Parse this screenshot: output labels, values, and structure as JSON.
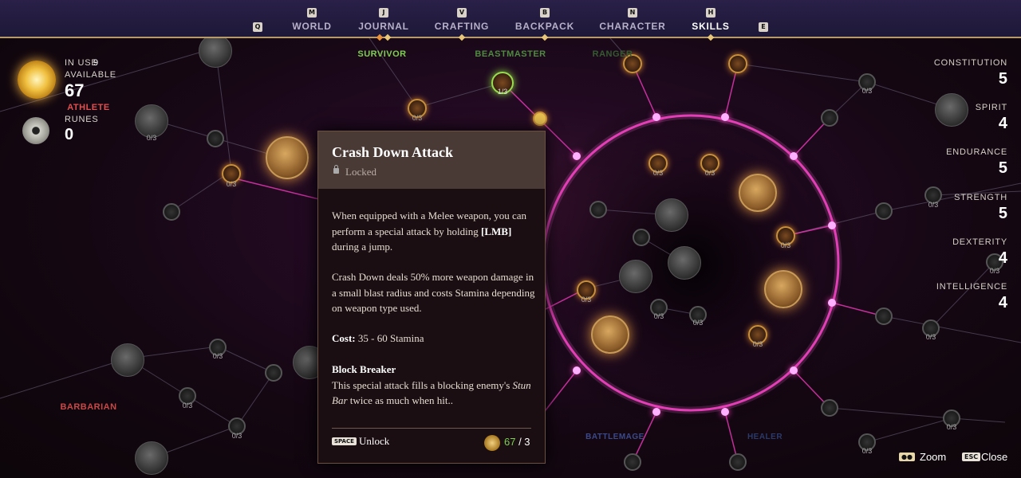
{
  "nav": {
    "items": [
      {
        "key": "Q",
        "label": ""
      },
      {
        "key": "M",
        "label": "WORLD"
      },
      {
        "key": "J",
        "label": "JOURNAL"
      },
      {
        "key": "V",
        "label": "CRAFTING"
      },
      {
        "key": "B",
        "label": "BACKPACK"
      },
      {
        "key": "N",
        "label": "CHARACTER"
      },
      {
        "key": "H",
        "label": "SKILLS"
      },
      {
        "key": "E",
        "label": ""
      }
    ],
    "active": "SKILLS"
  },
  "paths": {
    "survivor": "SURVIVOR",
    "beastmaster": "BEASTMASTER",
    "ranger": "RANGER",
    "athlete": "ATHLETE",
    "barbarian": "BARBARIAN",
    "battlemage": "BATTLEMAGE",
    "healer": "HEALER"
  },
  "hud": {
    "in_use_label": "IN USE",
    "in_use_value": "9",
    "available_label": "AVAILABLE",
    "available_value": "67",
    "runes_label": "RUNES",
    "runes_value": "0"
  },
  "stats": [
    {
      "label": "CONSTITUTION",
      "value": "5"
    },
    {
      "label": "SPIRIT",
      "value": "4"
    },
    {
      "label": "ENDURANCE",
      "value": "5"
    },
    {
      "label": "STRENGTH",
      "value": "5"
    },
    {
      "label": "DEXTERITY",
      "value": "4"
    },
    {
      "label": "INTELLIGENCE",
      "value": "4"
    }
  ],
  "node_labels": {
    "zero_of_three": "0/3",
    "one_of_three": "1/3"
  },
  "tooltip": {
    "title": "Crash Down Attack",
    "status": "Locked",
    "para1_a": "When equipped with a Melee weapon, you can perform a special attack by holding ",
    "para1_key": "[LMB]",
    "para1_b": " during a jump.",
    "para2": "Crash Down deals 50% more weapon damage in a small blast radius and costs Stamina depending on weapon type used.",
    "cost_label": "Cost:",
    "cost_value": " 35 - 60 Stamina",
    "perk_title": "Block Breaker",
    "perk_a": "This special attack fills a blocking enemy's ",
    "perk_em": "Stun Bar",
    "perk_b": " twice as much when hit..",
    "unlock_key": "SPACE",
    "unlock_label": "Unlock",
    "points_have": "67",
    "points_sep": " / 3"
  },
  "footer": {
    "zoom_label": "Zoom",
    "close_key": "ESC",
    "close_label": "Close"
  },
  "colors": {
    "accent_gold": "#e8c878",
    "glow_pink": "#ff40c0",
    "survivor_green": "#7fcf50",
    "barbarian_red": "#e05050"
  }
}
